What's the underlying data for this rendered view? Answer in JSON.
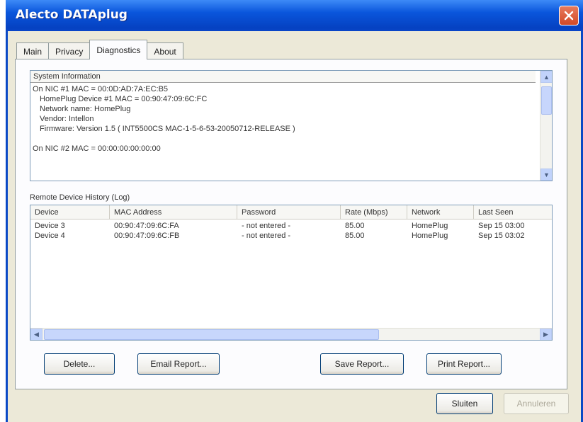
{
  "window": {
    "title": "Alecto DATAplug"
  },
  "tabs": [
    "Main",
    "Privacy",
    "Diagnostics",
    "About"
  ],
  "system_info": {
    "header": "System Information",
    "lines": [
      "On NIC #1 MAC = 00:0D:AD:7A:EC:B5",
      "  HomePlug Device #1 MAC = 00:90:47:09:6C:FC",
      "  Network name: HomePlug",
      "  Vendor: Intellon",
      "  Firmware: Version 1.5   ( INT5500CS MAC-1-5-6-53-20050712-RELEASE )",
      "",
      "On NIC #2 MAC = 00:00:00:00:00:00"
    ]
  },
  "log": {
    "title": "Remote Device History (Log)",
    "columns": [
      "Device",
      "MAC Address",
      "Password",
      "Rate (Mbps)",
      "Network",
      "Last Seen"
    ],
    "rows": [
      [
        "Device 3",
        "00:90:47:09:6C:FA",
        "- not entered -",
        "85.00",
        "HomePlug",
        "Sep 15 03:00"
      ],
      [
        "Device 4",
        "00:90:47:09:6C:FB",
        "- not entered -",
        "85.00",
        "HomePlug",
        "Sep 15 03:02"
      ]
    ]
  },
  "buttons": {
    "delete": "Delete...",
    "email_report": "Email Report...",
    "save_report": "Save Report...",
    "print_report": "Print Report...",
    "close": "Sluiten",
    "apply": "Annuleren"
  },
  "colors": {
    "titlebar": "#0a56dc",
    "window_bg": "#ece9d8",
    "close_button": "#d24a26"
  },
  "icons": {
    "close": "close-icon",
    "scroll_up": "chevron-up-icon",
    "scroll_down": "chevron-down-icon",
    "scroll_left": "chevron-left-icon",
    "scroll_right": "chevron-right-icon"
  }
}
